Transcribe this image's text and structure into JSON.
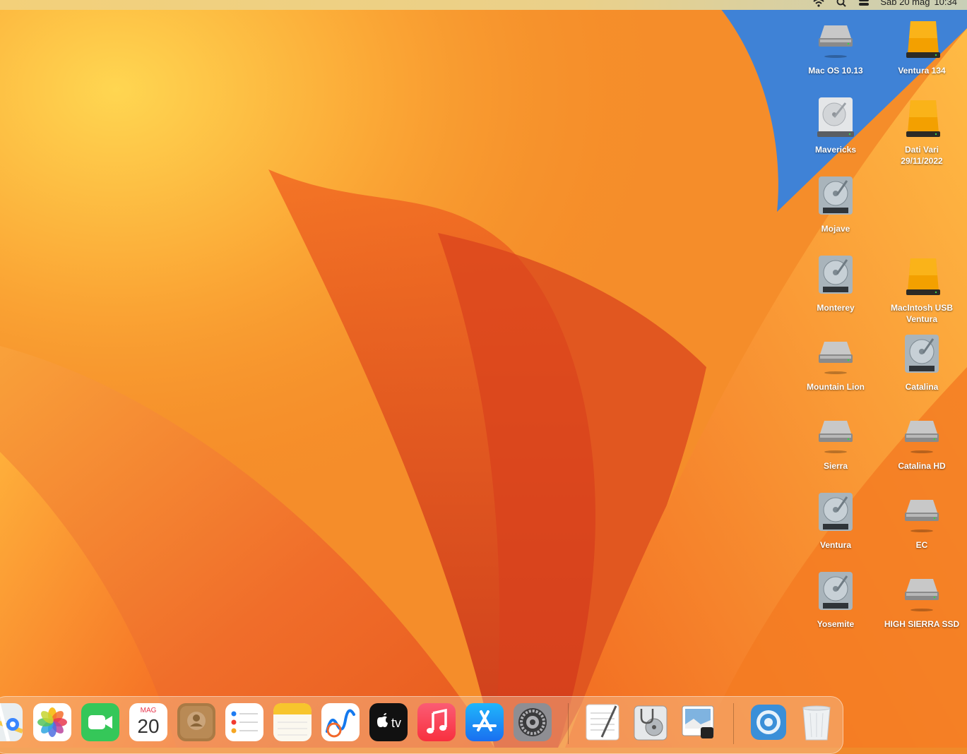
{
  "menubar": {
    "status_icons": [
      "wifi-icon",
      "spotlight-search-icon",
      "control-center-icon"
    ],
    "clock_day": "Sab 20 mag",
    "clock_time": "10:34"
  },
  "desktop": {
    "volumes": [
      {
        "name": "Mac OS 10.13",
        "icon": "external-drive-icon"
      },
      {
        "name": "Ventura 134",
        "icon": "usb-drive-orange-icon"
      },
      {
        "name": "Mavericks",
        "icon": "internal-hdd-icon"
      },
      {
        "name": "Dati Vari\n29/11/2022",
        "icon": "usb-drive-orange-icon"
      },
      {
        "name": "Mojave",
        "icon": "hdd-mechanism-icon"
      },
      {
        "name": "Monterey",
        "icon": "hdd-mechanism-icon"
      },
      {
        "name": "MacIntosh USB\nVentura",
        "icon": "usb-drive-orange-icon"
      },
      {
        "name": "Mountain Lion",
        "icon": "external-drive-icon"
      },
      {
        "name": "Catalina",
        "icon": "hdd-mechanism-icon"
      },
      {
        "name": "Sierra",
        "icon": "external-drive-icon"
      },
      {
        "name": "Catalina HD",
        "icon": "external-drive-icon"
      },
      {
        "name": "Ventura",
        "icon": "hdd-mechanism-icon"
      },
      {
        "name": "EC",
        "icon": "external-drive-icon"
      },
      {
        "name": "Yosemite",
        "icon": "hdd-mechanism-icon"
      },
      {
        "name": "HIGH SIERRA SSD",
        "icon": "external-drive-icon"
      }
    ]
  },
  "dock": {
    "apps": [
      {
        "icon": "maps-icon"
      },
      {
        "icon": "photos-icon"
      },
      {
        "icon": "facetime-icon"
      },
      {
        "icon": "calendar-icon",
        "month": "MAG",
        "day": "20"
      },
      {
        "icon": "contacts-icon"
      },
      {
        "icon": "reminders-icon"
      },
      {
        "icon": "notes-icon"
      },
      {
        "icon": "freeform-icon"
      },
      {
        "icon": "apple-tv-icon",
        "label": "tv"
      },
      {
        "icon": "music-icon"
      },
      {
        "icon": "app-store-icon"
      },
      {
        "icon": "system-settings-icon"
      },
      {
        "icon": "textedit-icon"
      },
      {
        "icon": "disk-utility-icon"
      },
      {
        "icon": "preview-icon"
      },
      {
        "icon": "downloads-stack-icon"
      },
      {
        "icon": "trash-icon"
      }
    ]
  },
  "colors": {
    "wallpaper_base": "#f08a2a",
    "wallpaper_blue": "#3f82d6",
    "wallpaper_red": "#d6341c",
    "drive_orange": "#f3a000"
  }
}
